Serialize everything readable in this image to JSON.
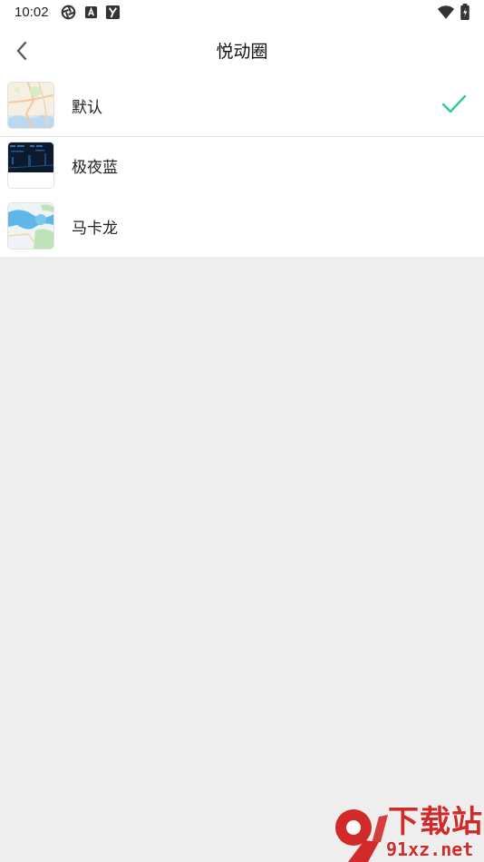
{
  "status_bar": {
    "time": "10:02",
    "left_icons": [
      "aperture-icon",
      "text-a-icon",
      "app-y-icon"
    ],
    "right_icons": [
      "wifi-icon",
      "battery-charging-icon"
    ]
  },
  "app_bar": {
    "back_icon": "chevron-left-icon",
    "title": "悦动圈"
  },
  "styles": [
    {
      "label": "默认",
      "thumb": "map-default-thumbnail",
      "selected": true
    },
    {
      "label": "极夜蓝",
      "thumb": "map-dark-blue-thumbnail",
      "selected": false
    },
    {
      "label": "马卡龙",
      "thumb": "map-macaron-thumbnail",
      "selected": false
    }
  ],
  "colors": {
    "check": "#2ec9a0",
    "watermark": "#d22a2a",
    "background": "#eeeeee"
  },
  "watermark": {
    "digit": "9",
    "title": "下载站",
    "domain": "91xz.net"
  }
}
